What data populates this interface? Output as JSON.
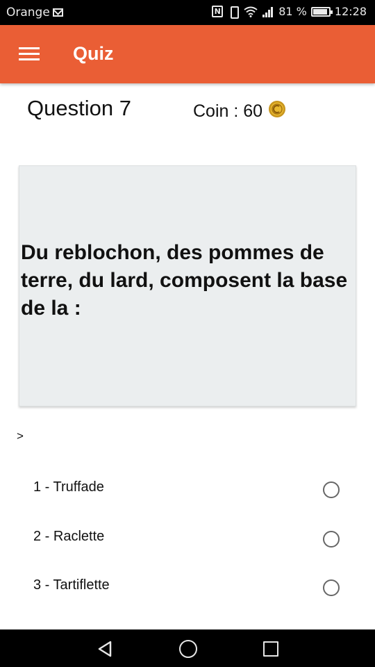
{
  "status_bar": {
    "carrier": "Orange",
    "battery": "81 %",
    "time": "12:28",
    "nfc_label": "N"
  },
  "app_bar": {
    "title": "Quiz",
    "color": "#ea5e35"
  },
  "header": {
    "question_number": "Question 7",
    "coin_label": "Coin : 60"
  },
  "question": {
    "text": "Du reblochon, des pommes de terre, du lard, composent la base de la :"
  },
  "marker": ">",
  "answers": [
    {
      "label": "1 - Truffade",
      "selected": false
    },
    {
      "label": "2 - Raclette",
      "selected": false
    },
    {
      "label": "3 - Tartiflette",
      "selected": false
    }
  ],
  "icons": {
    "menu": "hamburger-menu-icon",
    "coin": "gold-coin-icon",
    "nav_back": "triangle-back-icon",
    "nav_home": "circle-home-icon",
    "nav_recent": "square-recent-apps-icon"
  }
}
